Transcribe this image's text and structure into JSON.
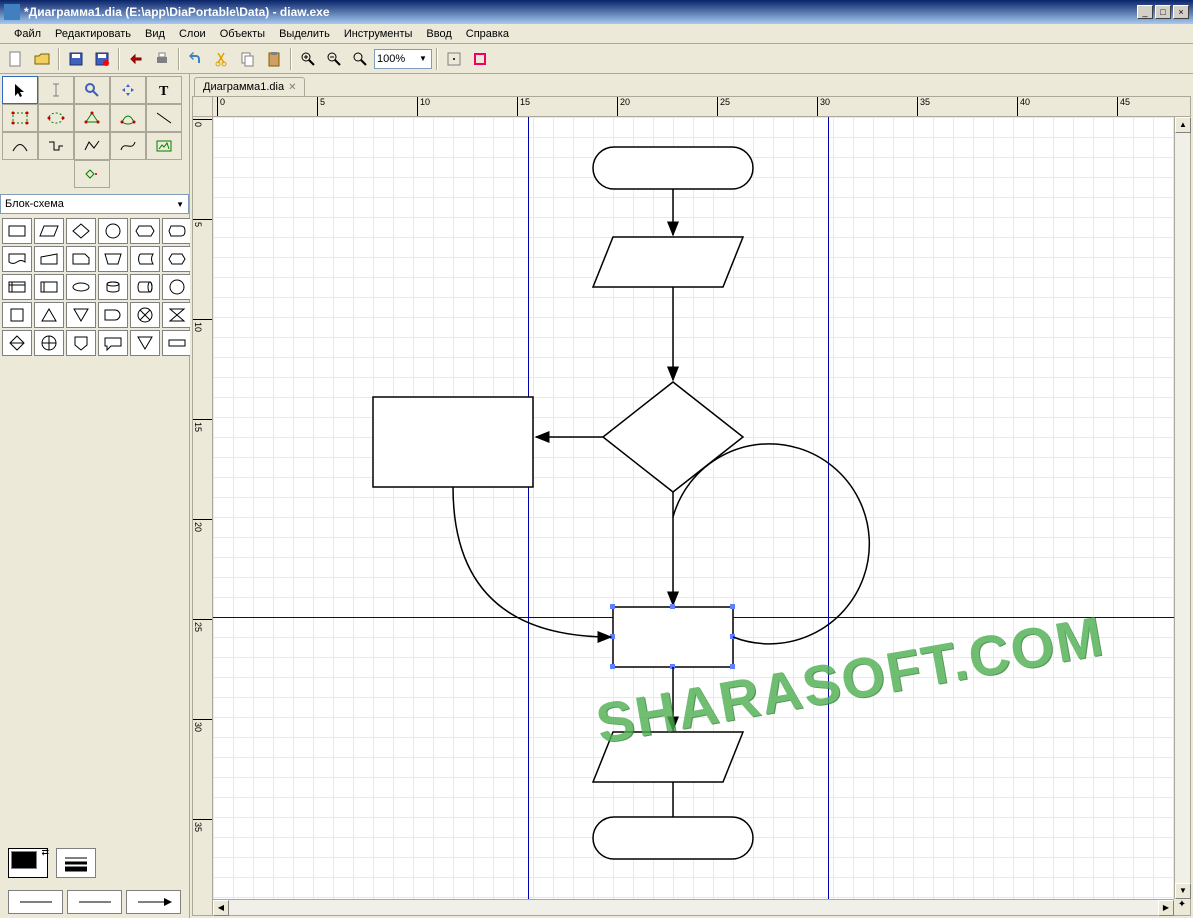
{
  "window": {
    "title": "*Диаграмма1.dia (E:\\app\\DiaPortable\\Data) - diaw.exe"
  },
  "menu": {
    "items": [
      "Файл",
      "Редактировать",
      "Вид",
      "Слои",
      "Объекты",
      "Выделить",
      "Инструменты",
      "Ввод",
      "Справка"
    ]
  },
  "toolbar": {
    "zoom_value": "100%"
  },
  "tab": {
    "label": "Диаграмма1.dia"
  },
  "shape_category": {
    "selected": "Блок-схема"
  },
  "ruler": {
    "h_ticks": [
      "0",
      "5",
      "10",
      "15",
      "20",
      "25",
      "30",
      "35",
      "40",
      "45"
    ],
    "v_ticks": [
      "0",
      "5",
      "10",
      "15",
      "20",
      "25",
      "30",
      "35"
    ]
  },
  "watermark": "SHARASOFT.COM",
  "tools": {
    "main": [
      "pointer",
      "text-cursor",
      "magnify",
      "move",
      "text"
    ],
    "shapes_row2": [
      "box",
      "ellipse",
      "polygon",
      "beziergon",
      "line"
    ],
    "shapes_row3": [
      "arc",
      "zigzag",
      "polyline",
      "bezier",
      "image"
    ],
    "shapes_row4": [
      "outline"
    ]
  },
  "flowchart_shapes": [
    "process",
    "parallelogram",
    "decision",
    "terminal",
    "preparation",
    "display",
    "document",
    "manual-input",
    "manual-op",
    "hexagon",
    "data",
    "internal-storage",
    "stored-data",
    "magnetic-disk",
    "direct-data",
    "connector",
    "card",
    "summing",
    "triangle",
    "collate",
    "circle-x",
    "hourglass",
    "sort",
    "or",
    "delay",
    "page-connector",
    "comment",
    "merge",
    "extract"
  ]
}
